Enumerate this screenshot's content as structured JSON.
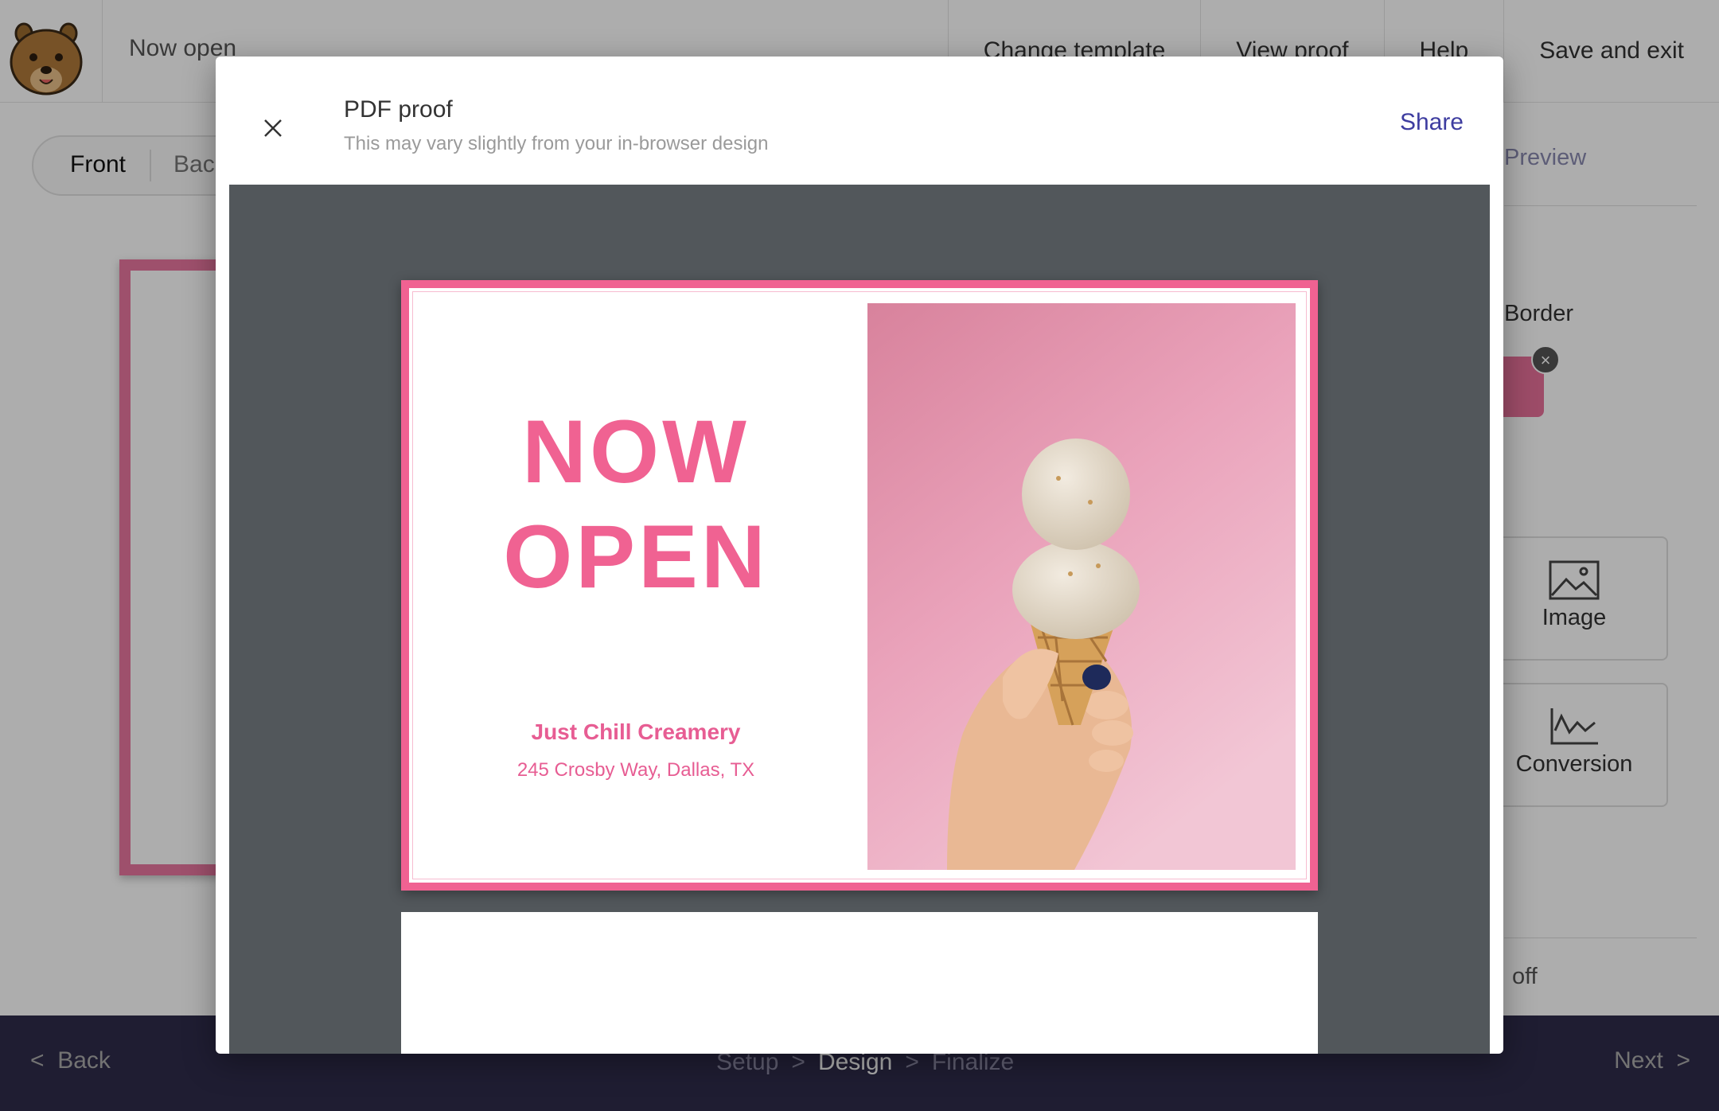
{
  "header": {
    "document_name": "Now open",
    "actions": [
      "Change template",
      "View proof",
      "Help",
      "Save and exit"
    ]
  },
  "editor": {
    "side_tabs": {
      "front": "Front",
      "back": "Back"
    }
  },
  "right_panel": {
    "preview_tab": "Preview",
    "border_label": "Border",
    "border_color": "#e8709a",
    "tools": [
      {
        "label": "Image",
        "icon": "image-icon"
      },
      {
        "label": "Conversion",
        "icon": "conversion-chart-icon"
      }
    ],
    "footer_text": "off"
  },
  "bottom_nav": {
    "back": "Back",
    "steps": [
      "Setup",
      "Design",
      "Finalize"
    ],
    "active_step": "Design",
    "next": "Next"
  },
  "modal": {
    "title": "PDF proof",
    "subtitle": "This may vary slightly from your in-browser design",
    "share": "Share"
  },
  "proof": {
    "headline_line1": "NOW",
    "headline_line2": "OPEN",
    "business_name": "Just Chill Creamery",
    "address": "245 Crosby Way, Dallas, TX",
    "accent_color": "#f06292",
    "photo_alt": "Hand holding ice cream cone against pink background"
  }
}
